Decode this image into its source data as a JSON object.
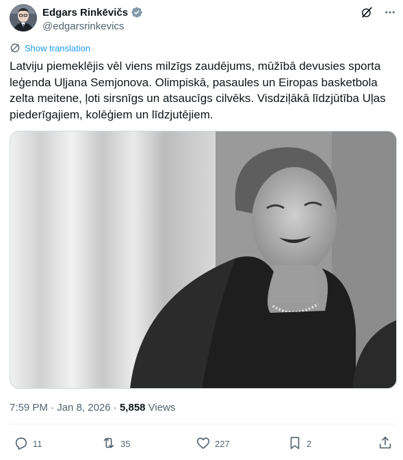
{
  "author": {
    "display_name": "Edgars Rinkēvičs",
    "handle": "@edgarsrinkevics",
    "verified_icon": "verified-badge-icon",
    "verified_color": "#829aab"
  },
  "header_icons": [
    "grok-icon",
    "more-icon"
  ],
  "translate": {
    "label": "Show translation",
    "icon": "translate-icon",
    "color": "#1d9bf0"
  },
  "tweet": {
    "text": "Latviju piemeklējis vēl viens milzīgs zaudējums, mūžībā devusies sporta\nleģenda Uļjana Semjonova. Olimpiskā, pasaules un Eiropas basketbola\nzelta meitene, ļoti sirsnīgs un atsaucīgs cilvēks. Visdziļākā līdzjūtība Uļas\npiederīgajiem, kolēģiem un līdzjutējiem."
  },
  "meta": {
    "time": "7:59 PM",
    "separator": " · ",
    "date": "Jan 8, 2026",
    "views_count": "5,858",
    "views_label": " Views"
  },
  "actions": {
    "replies": "11",
    "reposts": "35",
    "likes": "227",
    "bookmarks": "2"
  }
}
